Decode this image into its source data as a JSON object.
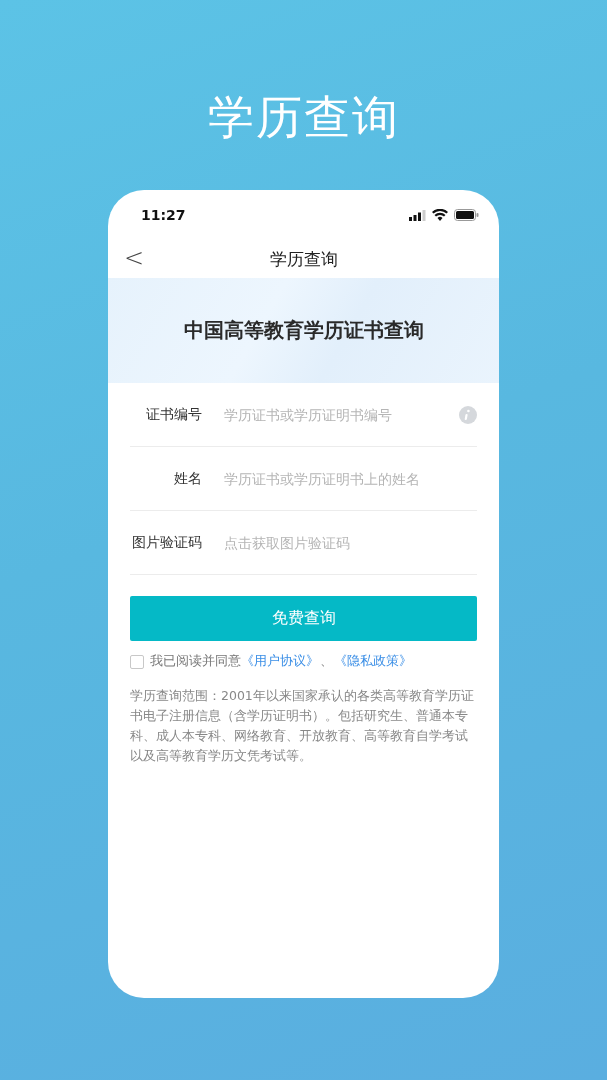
{
  "headline": "学历查询",
  "status_bar": {
    "time": "11:27"
  },
  "nav": {
    "back": "<",
    "title": "学历查询"
  },
  "banner": {
    "title": "中国高等教育学历证书查询"
  },
  "fields": [
    {
      "label": "证书编号",
      "placeholder": "学历证书或学历证明书编号",
      "info": true
    },
    {
      "label": "姓名",
      "placeholder": "学历证书或学历证明书上的姓名",
      "info": false
    },
    {
      "label": "图片验证码",
      "placeholder": "点击获取图片验证码",
      "info": false
    }
  ],
  "submit": "免费查询",
  "agreement": {
    "checked": false,
    "text": "我已阅读并同意",
    "links": [
      "《用户协议》",
      "《隐私政策》"
    ],
    "separator": "、"
  },
  "description": "学历查询范围：2001年以来国家承认的各类高等教育学历证书电子注册信息（含学历证明书）。包括研究生、普通本专科、成人本专科、网络教育、开放教育、高等教育自学考试以及高等教育学历文凭考试等。"
}
